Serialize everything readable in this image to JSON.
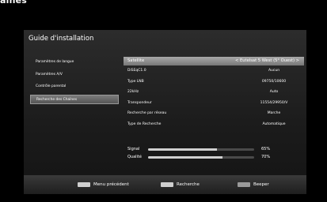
{
  "crop_title": "aines",
  "screen": {
    "title": "Guide d'installation"
  },
  "left_menu": [
    {
      "label": "Paramètres de langue"
    },
    {
      "label": "Paramètres A/V"
    },
    {
      "label": "Contrôle parental"
    },
    {
      "label": "Recherche des Chaînes",
      "active": true
    }
  ],
  "settings": {
    "header": {
      "label": "Satellite",
      "value": "< Eutelsat 5 West (5° Ouest) >"
    },
    "rows": [
      {
        "label": "DiSEqC1.0",
        "value": "Aucun"
      },
      {
        "label": "Type LNB",
        "value": "09750/10600"
      },
      {
        "label": "22kHz",
        "value": "Auto"
      },
      {
        "label": "Transpondeur",
        "value": "11554/29950/V"
      },
      {
        "label": "Recherche par réseau",
        "value": "Marche"
      },
      {
        "label": "Type de Recherche",
        "value": "Automatique"
      }
    ]
  },
  "meters": [
    {
      "label": "Signal",
      "value_text": "65%",
      "level": 65
    },
    {
      "label": "Qualité",
      "value_text": "70%",
      "level": 70
    }
  ],
  "footer": {
    "buttons": [
      {
        "label": "Menu précédent"
      },
      {
        "label": "Recherche"
      },
      {
        "label": "Beeper"
      }
    ]
  }
}
